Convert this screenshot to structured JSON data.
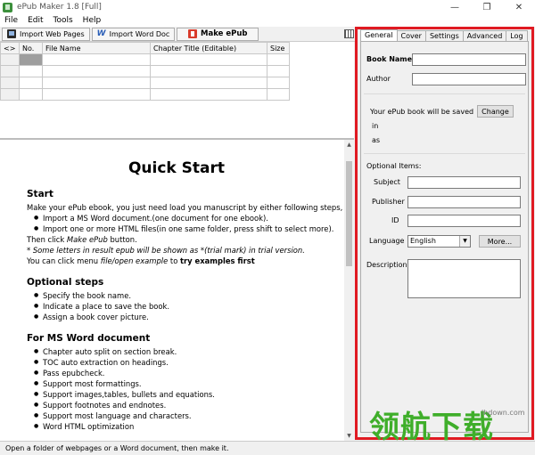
{
  "window": {
    "title": "ePub Maker 1.8 [Full]"
  },
  "menu": [
    "File",
    "Edit",
    "Tools",
    "Help"
  ],
  "toolbar": {
    "import_web": "Import Web Pages",
    "import_word": "Import Word Doc",
    "make_epub": "Make ePub"
  },
  "grid": {
    "columns": [
      "<>",
      "No.",
      "File Name",
      "Chapter Title (Editable)",
      "Size"
    ],
    "rows": [
      [
        "",
        "",
        "",
        "",
        ""
      ],
      [
        "",
        "",
        "",
        "",
        ""
      ],
      [
        "",
        "",
        "",
        "",
        ""
      ],
      [
        "",
        "",
        "",
        "",
        ""
      ]
    ]
  },
  "doc": {
    "title": "Quick Start",
    "start_heading": "Start",
    "start_intro": "Make your ePub ebook, you just need load you manuscript by either following steps,",
    "start_items": [
      "Import a MS Word document.(one document for one ebook).",
      "Import one or more HTML files(in one same folder, press shift to select more)."
    ],
    "then_click_prefix": "Then click ",
    "then_click_em": "Make ePub",
    "then_click_suffix": " button.",
    "trial_note": "* Some letters in result epub will be shown as *(trial mark) in trial version.",
    "example_prefix": "You can click menu ",
    "example_em": "file/open example",
    "example_mid": " to ",
    "example_bold": "try examples first",
    "optional_heading": "Optional steps",
    "optional_items": [
      "Specify the book name.",
      "Indicate a place to save the book.",
      "Assign a book cover picture."
    ],
    "word_heading": "For MS Word document",
    "word_items": [
      "Chapter auto split on section break.",
      "TOC auto extraction on headings.",
      "Pass epubcheck.",
      "Support most formattings.",
      "Support images,tables, bullets and equations.",
      "Support footnotes and endnotes.",
      "Support most language and characters.",
      "Word HTML optimization"
    ]
  },
  "status": "Open a folder of webpages or a Word document, then make it.",
  "panel": {
    "tabs": [
      "General",
      "Cover",
      "Settings",
      "Advanced",
      "Log"
    ],
    "book_name_label": "Book Name",
    "author_label": "Author",
    "saved_text": "Your ePub book will be saved",
    "in_label": "in",
    "as_label": "as",
    "change_button": "Change",
    "optional_label": "Optional Items:",
    "subject_label": "Subject",
    "publisher_label": "Publisher",
    "id_label": "ID",
    "language_label": "Language",
    "language_value": "English",
    "more_button": "More...",
    "description_label": "Description"
  },
  "watermark": {
    "text": "领航下载",
    "url": "lhdown.com"
  },
  "colors": {
    "highlight_border": "#e01a22",
    "watermark": "#3fae2a"
  }
}
